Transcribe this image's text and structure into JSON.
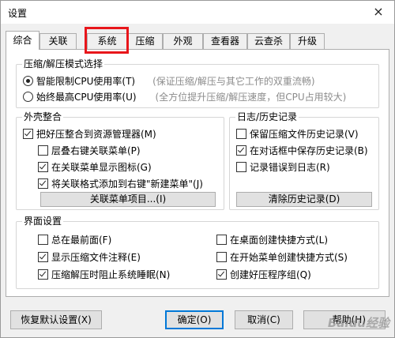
{
  "window": {
    "title": "设置",
    "close_icon": "×"
  },
  "tabs": [
    {
      "label": "综合"
    },
    {
      "label": "关联"
    },
    {
      "label": "系统"
    },
    {
      "label": "压缩"
    },
    {
      "label": "外观"
    },
    {
      "label": "查看器"
    },
    {
      "label": "云查杀"
    },
    {
      "label": "升级"
    }
  ],
  "group_mode": {
    "title": "压缩/解压模式选择",
    "option1": {
      "label": "智能限制CPU使用率(T)",
      "hint": "(保证压缩/解压与其它工作的双重流畅)",
      "selected": true
    },
    "option2": {
      "label": "始终最高CPU使用率(U)",
      "hint": "(全方位提升压缩/解压速度，但CPU占用较大)",
      "selected": false
    }
  },
  "group_shell": {
    "title": "外壳整合",
    "items": [
      {
        "label": "把好压整合到资源管理器(M)",
        "checked": true
      },
      {
        "label": "层叠右键关联菜单(P)",
        "checked": false
      },
      {
        "label": "在关联菜单显示图标(G)",
        "checked": true
      },
      {
        "label": "将关联格式添加到右键\"新建菜单\"(J)",
        "checked": true
      }
    ],
    "button": "关联菜单项目...(I)"
  },
  "group_log": {
    "title": "日志/历史记录",
    "items": [
      {
        "label": "保留压缩文件历史记录(V)",
        "checked": false
      },
      {
        "label": "在对话框中保存历史记录(B)",
        "checked": true
      },
      {
        "label": "记录错误到日志(R)",
        "checked": false
      }
    ],
    "button": "清除历史记录(D)"
  },
  "group_ui": {
    "title": "界面设置",
    "left": [
      {
        "label": "总在最前面(F)",
        "checked": false
      },
      {
        "label": "显示压缩文件注释(E)",
        "checked": true
      },
      {
        "label": "压缩解压时阻止系统睡眠(N)",
        "checked": true
      }
    ],
    "right": [
      {
        "label": "在桌面创建快捷方式(L)",
        "checked": false
      },
      {
        "label": "在开始菜单创建快捷方式(S)",
        "checked": false
      },
      {
        "label": "创建好压程序组(Q)",
        "checked": true
      }
    ]
  },
  "footer": {
    "reset": "恢复默认设置(X)",
    "ok": "确定(O)",
    "cancel": "取消(C)",
    "help": "帮助(H)"
  },
  "watermark": "Baidu经验"
}
